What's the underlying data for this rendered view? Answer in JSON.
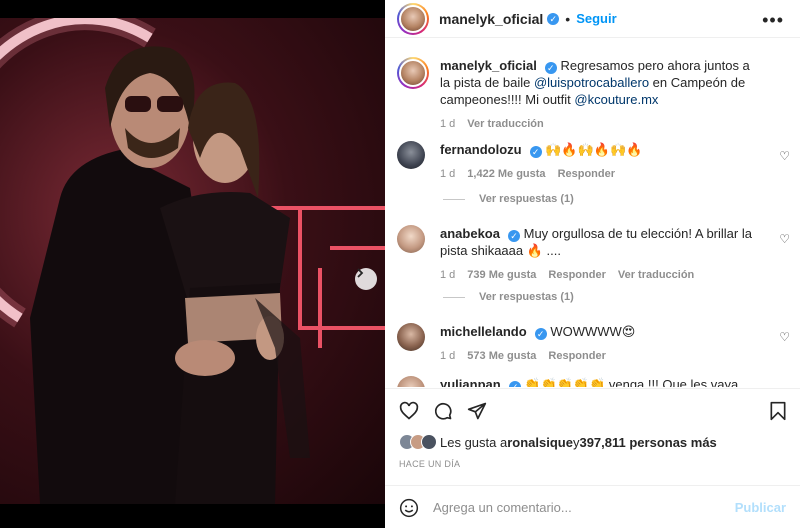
{
  "post": {
    "username": "manelyk_oficial",
    "follow_label": "Seguir",
    "more_icon": "more-options-icon",
    "caption": {
      "text_before": "Regresamos pero ahora juntos a la pista de baile ",
      "mention1": "@luispotrocaballero",
      "text_middle": " en Campeón de campeones!!!! Mi outfit ",
      "mention2": "@kcouture.mx",
      "time": "1 d",
      "translate": "Ver traducción"
    }
  },
  "comments": [
    {
      "username": "fernandolozu",
      "verified": true,
      "text": "🙌🔥🙌🔥🙌🔥",
      "time": "1 d",
      "likes": "1,422 Me gusta",
      "reply": "Responder",
      "view_replies": "Ver respuestas (1)"
    },
    {
      "username": "anabekoa",
      "verified": true,
      "text": "Muy orgullosa de tu elección! A brillar la pista shikaaaa 🔥 ....",
      "time": "1 d",
      "likes": "739 Me gusta",
      "reply": "Responder",
      "translate": "Ver traducción",
      "view_replies": "Ver respuestas (1)"
    },
    {
      "username": "michellelando",
      "verified": true,
      "text": "WOWWWW😍",
      "time": "1 d",
      "likes": "573 Me gusta",
      "reply": "Responder"
    },
    {
      "username": "yulianpan",
      "verified": true,
      "text": "👏👏👏👏👏 venga !!! Que les vaya increíble !!!"
    }
  ],
  "actions": {
    "like_icon": "heart-icon",
    "comment_icon": "comment-icon",
    "share_icon": "share-icon",
    "save_icon": "bookmark-icon"
  },
  "likes_summary": {
    "prefix": "Les gusta a ",
    "user": "ronalsique",
    "middle": " y ",
    "count": "397,811 personas más"
  },
  "time_ago": "HACE UN DÍA",
  "comment_box": {
    "placeholder": "Agrega un comentario...",
    "publish_label": "Publicar"
  },
  "carousel": {
    "current": 1,
    "total": 4
  },
  "colors": {
    "accent": "#0095f6",
    "verified": "#3897f0",
    "muted": "#8e8e8e"
  }
}
